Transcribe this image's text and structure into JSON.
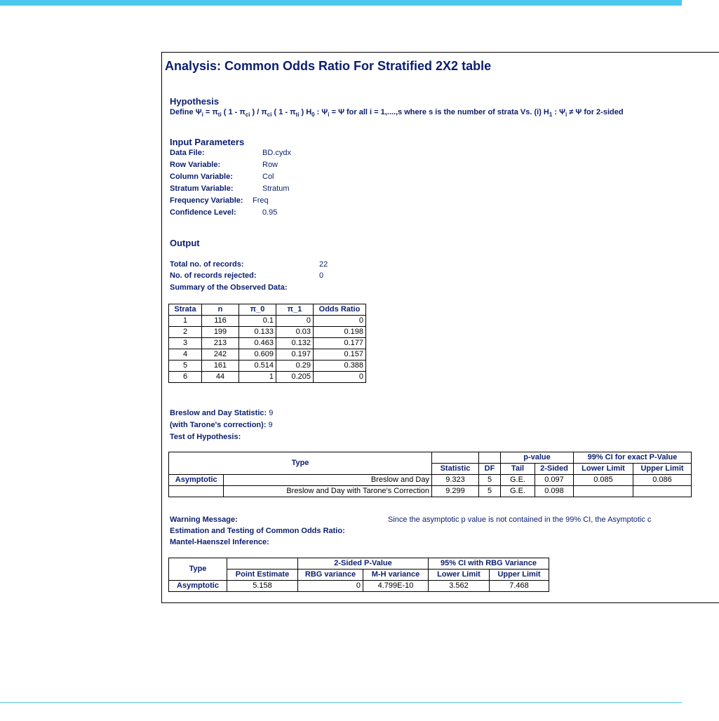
{
  "report": {
    "title": "Analysis: Common Odds Ratio For Stratified 2X2 table",
    "hypothesis": {
      "heading": "Hypothesis",
      "define_label": "Define",
      "text": "Ψ i = π ti ( 1 - π ci ) / π ci ( 1 - π ti ) H 0 : Ψ i = Ψ for all i = 1,....,s where s is the number of strata Vs. (i) H 1 : Ψ i ≠ Ψ for 2-sided"
    },
    "input_parameters": {
      "heading": "Input Parameters",
      "items": [
        {
          "label": "Data File:",
          "value": "BD.cydx"
        },
        {
          "label": "Row Variable:",
          "value": "Row"
        },
        {
          "label": "Column Variable:",
          "value": "Col"
        },
        {
          "label": "Stratum Variable:",
          "value": "Stratum"
        },
        {
          "label": "Frequency Variable:",
          "value": "Freq"
        },
        {
          "label": "Confidence Level:",
          "value": "0.95"
        }
      ]
    },
    "output": {
      "heading": "Output",
      "total_records_label": "Total no. of records:",
      "total_records_value": "22",
      "rejected_label": "No. of records rejected:",
      "rejected_value": "0",
      "summary_label": "Summary of the Observed Data:"
    },
    "summary_table": {
      "headers": [
        "Strata",
        "n",
        "π_0",
        "π_1",
        "Odds Ratio"
      ],
      "rows": [
        [
          "1",
          "116",
          "0.1",
          "0",
          "0"
        ],
        [
          "2",
          "199",
          "0.133",
          "0.03",
          "0.198"
        ],
        [
          "3",
          "213",
          "0.463",
          "0.132",
          "0.177"
        ],
        [
          "4",
          "242",
          "0.609",
          "0.197",
          "0.157"
        ],
        [
          "5",
          "161",
          "0.514",
          "0.29",
          "0.388"
        ],
        [
          "6",
          "44",
          "1",
          "0.205",
          "0"
        ]
      ]
    },
    "breslow": {
      "stat_label": "Breslow and Day Statistic:",
      "stat_value": "9",
      "tarone_label": "(with Tarone's correction):",
      "tarone_value": "9",
      "test_label": "Test of Hypothesis:"
    },
    "test_table": {
      "type_header": "Type",
      "pvalue_header": "p-value",
      "ci_header": "99% CI for exact P-Value",
      "statistic_header": "Statistic",
      "df_header": "DF",
      "tail_header": "Tail",
      "two_sided_header": "2-Sided",
      "lower_header": "Lower Limit",
      "upper_header": "Upper Limit",
      "rows": [
        {
          "group": "Asymptotic",
          "name": "Breslow and Day",
          "statistic": "9.323",
          "df": "5",
          "tail": "G.E.",
          "two_sided": "0.097",
          "lower": "0.085",
          "upper": "0.086"
        },
        {
          "group": "",
          "name": "Breslow and Day with Tarone's Correction",
          "statistic": "9.299",
          "df": "5",
          "tail": "G.E.",
          "two_sided": "0.098",
          "lower": "",
          "upper": ""
        }
      ]
    },
    "warning": {
      "label": "Warning Message:",
      "text": "Since the asymptotic p value is not contained in the 99% CI, the Asymptotic c"
    },
    "estimation_label": "Estimation and Testing of Common Odds Ratio:",
    "mh_label": "Mantel-Haenszel Inference:",
    "mh_table": {
      "type_header": "Type",
      "two_sided_header": "2-Sided P-Value",
      "ci_header": "95% CI with RBG Variance",
      "point_header": "Point Estimate",
      "rbg_header": "RBG variance",
      "mh_header": "M-H variance",
      "lower_header": "Lower Limit",
      "upper_header": "Upper Limit",
      "row": {
        "type": "Asymptotic",
        "point": "5.158",
        "rbg": "0",
        "mh": "4.799E-10",
        "lower": "3.562",
        "upper": "7.468"
      }
    }
  },
  "colors": {
    "accent": "#4dc8ee",
    "heading": "#0b1e6e"
  }
}
